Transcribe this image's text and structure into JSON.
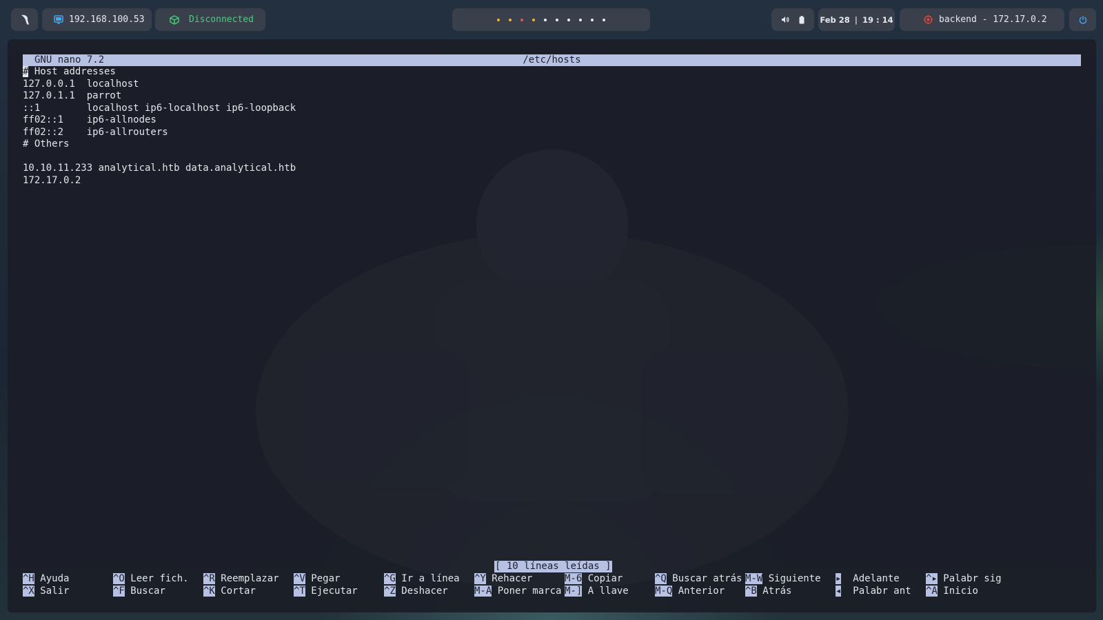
{
  "topbar": {
    "logo_icon": "parrot-logo-icon",
    "ip_address": "192.168.100.53",
    "ip_icon": "monitor-icon",
    "vpn_status": "Disconnected",
    "vpn_icon": "cube-icon",
    "workspace_dot_colors": [
      "#f0b429",
      "#f0b429",
      "#e05a4f",
      "#f0b429",
      "#e9ecf1",
      "#e9ecf1",
      "#e9ecf1",
      "#e9ecf1",
      "#e9ecf1",
      "#e9ecf1"
    ],
    "sys_icons": [
      "volume-icon",
      "battery-icon"
    ],
    "date": "Feb 28",
    "time_h": "19",
    "time_m": "14",
    "target_icon": "target-icon",
    "target_label": "backend - 172.17.0.2",
    "power_icon": "power-icon"
  },
  "nano": {
    "version": "GNU nano 7.2",
    "filename": "/etc/hosts",
    "lines": [
      "# Host addresses",
      "127.0.0.1  localhost",
      "127.0.1.1  parrot",
      "::1        localhost ip6-localhost ip6-loopback",
      "ff02::1    ip6-allnodes",
      "ff02::2    ip6-allrouters",
      "# Others",
      "",
      "10.10.11.233 analytical.htb data.analytical.htb",
      "172.17.0.2"
    ],
    "status": "[ 10 líneas leídas ]",
    "shortcuts_row1": [
      {
        "key": "^H",
        "label": "Ayuda"
      },
      {
        "key": "^O",
        "label": "Leer fich."
      },
      {
        "key": "^R",
        "label": "Reemplazar"
      },
      {
        "key": "^V",
        "label": "Pegar"
      },
      {
        "key": "^G",
        "label": "Ir a línea"
      },
      {
        "key": "^Y",
        "label": "Rehacer"
      },
      {
        "key": "M-6",
        "label": "Copiar"
      },
      {
        "key": "^Q",
        "label": "Buscar atrás"
      },
      {
        "key": "M-W",
        "label": "Siguiente"
      },
      {
        "key": "▸",
        "label": "Adelante"
      },
      {
        "key": "^▸",
        "label": "Palabr sig"
      }
    ],
    "shortcuts_row2": [
      {
        "key": "^X",
        "label": "Salir"
      },
      {
        "key": "^F",
        "label": "Buscar"
      },
      {
        "key": "^K",
        "label": "Cortar"
      },
      {
        "key": "^T",
        "label": "Ejecutar"
      },
      {
        "key": "^Z",
        "label": "Deshacer"
      },
      {
        "key": "M-A",
        "label": "Poner marca"
      },
      {
        "key": "M-]",
        "label": "A llave"
      },
      {
        "key": "M-Q",
        "label": "Anterior"
      },
      {
        "key": "^B",
        "label": "Atrás"
      },
      {
        "key": "◂",
        "label": "Palabr ant"
      },
      {
        "key": "^A",
        "label": "Inicio"
      }
    ]
  }
}
